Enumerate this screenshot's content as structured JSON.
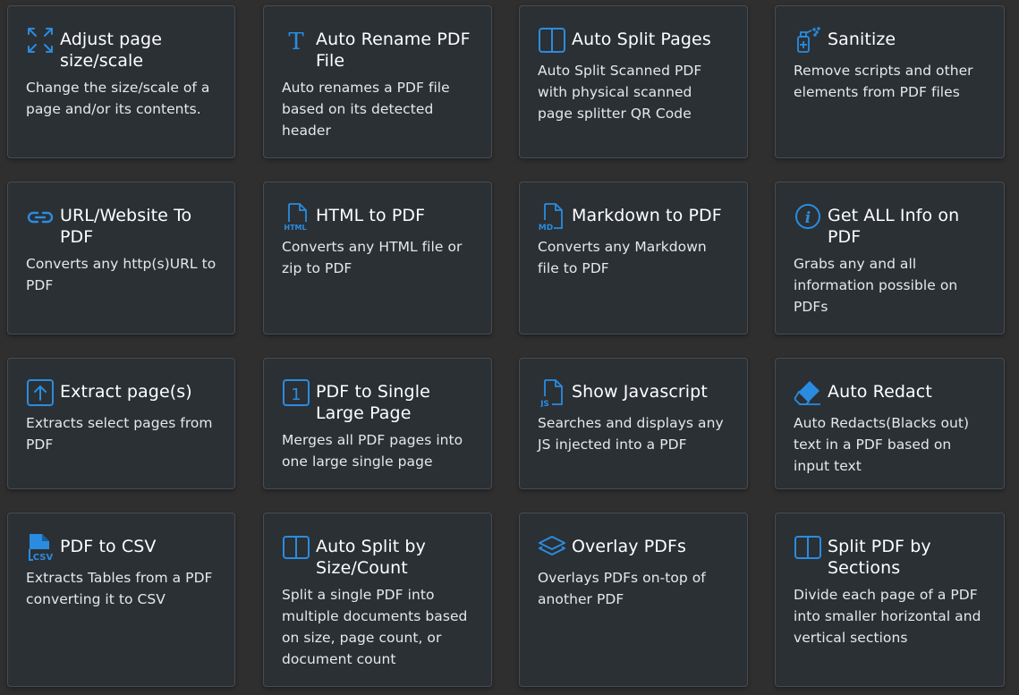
{
  "accent_color": "#2a8ce0",
  "cards": [
    {
      "title": "Adjust page size/scale",
      "desc": "Change the size/scale of a page and/or its contents.",
      "icon": "arrows-expand-icon"
    },
    {
      "title": "Auto Rename PDF File",
      "desc": "Auto renames a PDF file based on its detected header",
      "icon": "text-t-icon"
    },
    {
      "title": "Auto Split Pages",
      "desc": "Auto Split Scanned PDF with physical scanned page splitter QR Code",
      "icon": "split-page-icon"
    },
    {
      "title": "Sanitize",
      "desc": "Remove scripts and other elements from PDF files",
      "icon": "sanitize-spray-icon"
    },
    {
      "title": "URL/Website To PDF",
      "desc": "Converts any http(s)URL to PDF",
      "icon": "link-icon"
    },
    {
      "title": "HTML to PDF",
      "desc": "Converts any HTML file or zip to PDF",
      "icon": "html-file-icon"
    },
    {
      "title": "Markdown to PDF",
      "desc": "Converts any Markdown file to PDF",
      "icon": "markdown-file-icon"
    },
    {
      "title": "Get ALL Info on PDF",
      "desc": "Grabs any and all information possible on PDFs",
      "icon": "info-circle-icon"
    },
    {
      "title": "Extract page(s)",
      "desc": "Extracts select pages from PDF",
      "icon": "extract-arrow-up-icon"
    },
    {
      "title": "PDF to Single Large Page",
      "desc": "Merges all PDF pages into one large single page",
      "icon": "single-page-1-icon"
    },
    {
      "title": "Show Javascript",
      "desc": "Searches and displays any JS injected into a PDF",
      "icon": "js-file-icon"
    },
    {
      "title": "Auto Redact",
      "desc": "Auto Redacts(Blacks out) text in a PDF based on input text",
      "icon": "eraser-icon"
    },
    {
      "title": "PDF to CSV",
      "desc": "Extracts Tables from a PDF converting it to CSV",
      "icon": "csv-file-icon"
    },
    {
      "title": "Auto Split by Size/Count",
      "desc": "Split a single PDF into multiple documents based on size, page count, or document count",
      "icon": "split-layout-icon"
    },
    {
      "title": "Overlay PDFs",
      "desc": "Overlays PDFs on-top of another PDF",
      "icon": "layers-icon"
    },
    {
      "title": "Split PDF by Sections",
      "desc": "Divide each page of a PDF into smaller horizontal and vertical sections",
      "icon": "split-sections-icon"
    }
  ]
}
